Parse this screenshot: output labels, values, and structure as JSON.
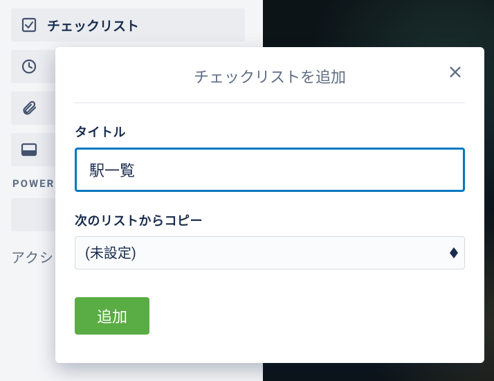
{
  "sidebar": {
    "checklist_label": "チェックリスト",
    "powerups_label": "POWER-UP",
    "action_label": "アクション"
  },
  "modal": {
    "title": "チェックリストを追加",
    "field_title_label": "タイトル",
    "title_value": "駅一覧",
    "copy_from_label": "次のリストからコピー",
    "copy_from_selected": "(未設定)",
    "add_button_label": "追加"
  }
}
